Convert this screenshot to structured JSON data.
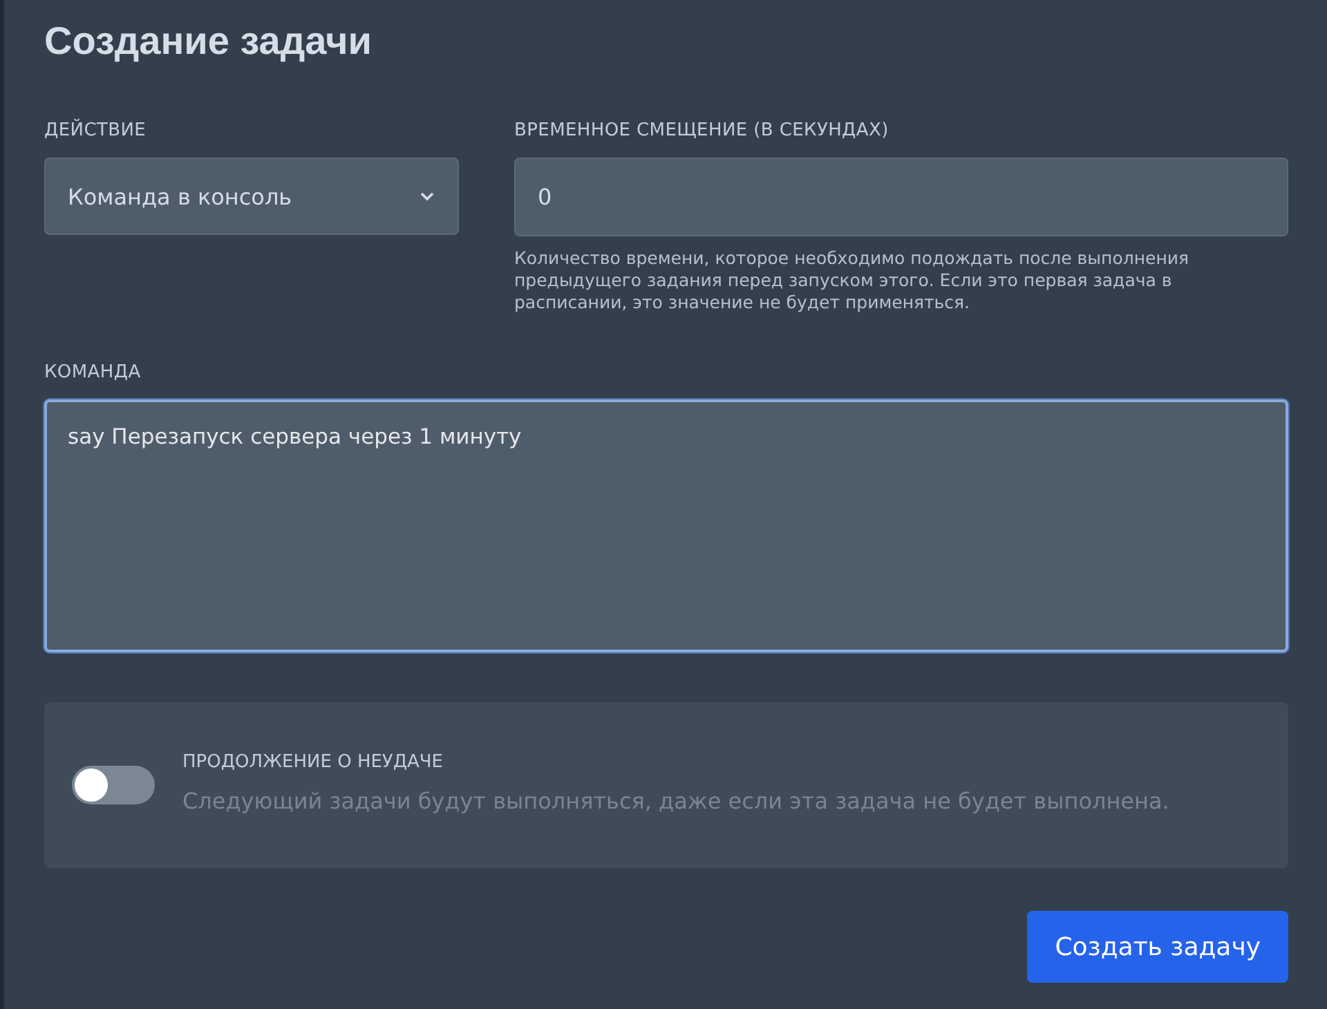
{
  "title": "Создание задачи",
  "action": {
    "label": "ДЕЙСТВИЕ",
    "value": "Команда в консоль"
  },
  "offset": {
    "label": "ВРЕМЕННОЕ СМЕЩЕНИЕ (В СЕКУНДАХ)",
    "value": "0",
    "hint": "Количество времени, которое необходимо подождать после выполнения предыдущего задания перед запуском этого. Если это первая задача в расписании, это значение не будет применяться."
  },
  "command": {
    "label": "КОМАНДА",
    "value": "say Перезапуск сервера через 1 минуту",
    "focused": true
  },
  "continue_on_failure": {
    "title": "ПРОДОЛЖЕНИЕ О НЕУДАЧЕ",
    "description": "Следующий задачи будут выполняться, даже если эта задача не будет выполнена.",
    "on": false
  },
  "buttons": [
    {
      "label": "Создать задачу"
    }
  ]
}
